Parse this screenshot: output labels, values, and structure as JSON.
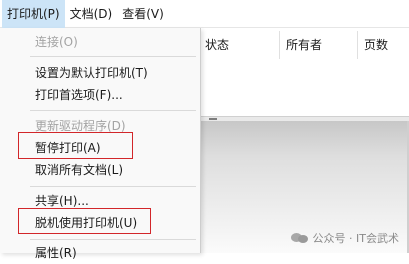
{
  "menubar": {
    "items": [
      "打印机(P)",
      "文档(D)",
      "查看(V)"
    ]
  },
  "list": {
    "columns": [
      "状态",
      "所有者",
      "页数"
    ]
  },
  "menu": {
    "items": [
      "连接(O)",
      "设置为默认打印机(T)",
      "打印首选项(F)...",
      "更新驱动程序(D)",
      "暂停打印(A)",
      "取消所有文档(L)",
      "共享(H)...",
      "脱机使用打印机(U)",
      "属性(R)"
    ],
    "disabled": [
      "连接(O)",
      "更新驱动程序(D)"
    ]
  },
  "colors": {
    "highlight_box": "#d2262a",
    "menu_bg": "#f9f9f9",
    "open_menu_bg": "#cce4f7"
  },
  "watermark": {
    "text": "公众号 · IT会武术",
    "icon": "wechat-icon"
  }
}
